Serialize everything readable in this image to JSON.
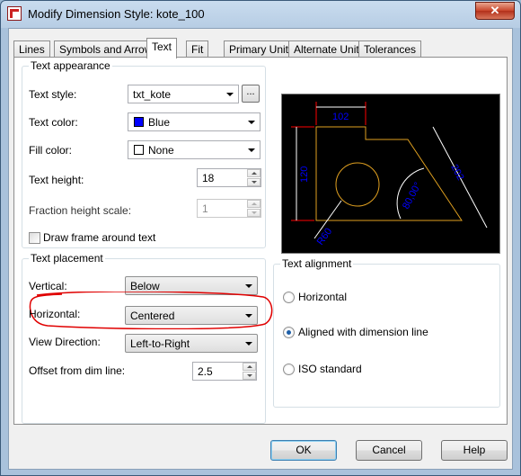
{
  "window": {
    "title": "Modify Dimension Style: kote_100",
    "close_glyph": "✕"
  },
  "tabs": [
    {
      "label": "Lines"
    },
    {
      "label": "Symbols and Arrows"
    },
    {
      "label": "Text"
    },
    {
      "label": "Fit"
    },
    {
      "label": "Primary Units"
    },
    {
      "label": "Alternate Units"
    },
    {
      "label": "Tolerances"
    }
  ],
  "text_appearance": {
    "legend": "Text appearance",
    "text_style_label": "Text style:",
    "text_style_value": "txt_kote",
    "browse_label": "...",
    "text_color_label": "Text color:",
    "text_color_value": "Blue",
    "text_color_swatch": "#0000ff",
    "fill_color_label": "Fill color:",
    "fill_color_value": "None",
    "text_height_label": "Text height:",
    "text_height_value": "18",
    "fraction_label": "Fraction height scale:",
    "fraction_value": "1",
    "draw_frame_label": "Draw frame around text",
    "draw_frame_checked": false
  },
  "text_placement": {
    "legend": "Text placement",
    "vertical_label": "Vertical:",
    "vertical_value": "Below",
    "horizontal_label": "Horizontal:",
    "horizontal_value": "Centered",
    "view_direction_label": "View Direction:",
    "view_direction_value": "Left-to-Right",
    "offset_label": "Offset from dim line:",
    "offset_value": "2.5",
    "highlight_color": "#e00000"
  },
  "text_alignment": {
    "legend": "Text alignment",
    "options": [
      {
        "label": "Horizontal",
        "checked": false
      },
      {
        "label": "Aligned with dimension line",
        "checked": true
      },
      {
        "label": "ISO standard",
        "checked": false
      }
    ]
  },
  "preview": {
    "dims": [
      "102",
      "120",
      "202",
      "R60",
      "80,00°"
    ],
    "geometry_color": "#e0a020",
    "dim_text_color": "#0000ff",
    "dim_line_color": "#ffffff",
    "extension_color": "#ff0000"
  },
  "buttons": {
    "ok": "OK",
    "cancel": "Cancel",
    "help": "Help"
  }
}
